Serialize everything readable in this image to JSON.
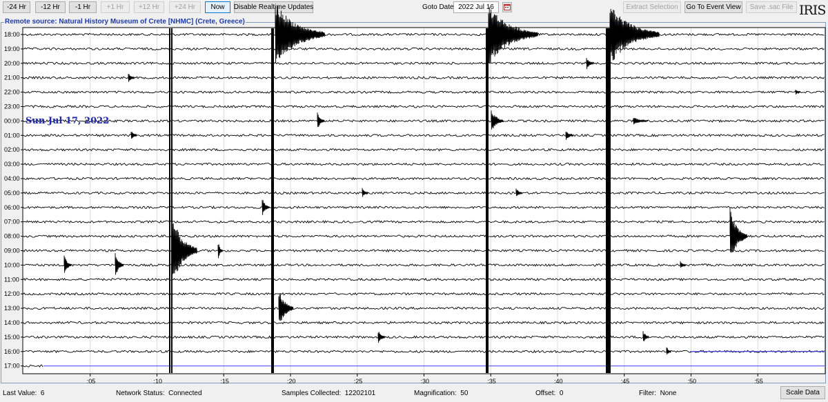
{
  "toolbar": {
    "buttons": [
      {
        "label": "-24 Hr",
        "enabled": true
      },
      {
        "label": "-12 Hr",
        "enabled": true
      },
      {
        "label": "-1 Hr",
        "enabled": true
      },
      {
        "label": "+1 Hr",
        "enabled": false
      },
      {
        "label": "+12 Hr",
        "enabled": false
      },
      {
        "label": "+24 Hr",
        "enabled": false
      },
      {
        "label": "Now",
        "enabled": true
      },
      {
        "label": "Disable Realtime Updates",
        "enabled": true
      }
    ],
    "goto_label": "Goto Date:",
    "goto_value": "2022 Jul 16",
    "right_buttons": [
      {
        "label": "Extract Selection",
        "enabled": false
      },
      {
        "label": "Go To Event View",
        "enabled": true
      },
      {
        "label": "Save .sac File",
        "enabled": false
      }
    ],
    "logo_text": "IRIS"
  },
  "source_title": "Remote source: Natural History Museum of Crete [NHMC] (Crete, Greece)",
  "date_annotation": "Sun Jul 17, 2022",
  "helicorder": {
    "hour_labels": [
      "18:00",
      "19:00",
      "20:00",
      "21:00",
      "22:00",
      "23:00",
      "00:00",
      "01:00",
      "02:00",
      "03:00",
      "04:00",
      "05:00",
      "06:00",
      "07:00",
      "08:00",
      "09:00",
      "10:00",
      "11:00",
      "12:00",
      "13:00",
      "14:00",
      "15:00",
      "16:00",
      "17:00"
    ],
    "minute_labels": [
      ":05",
      ":10",
      ":15",
      ":20",
      ":25",
      ":30",
      ":35",
      ":40",
      ":45",
      ":50",
      ":55"
    ],
    "minute_values": [
      5,
      10,
      15,
      20,
      25,
      30,
      35,
      40,
      45,
      50,
      55
    ],
    "minutes_per_line": 60,
    "last_trace_end_minute": 1.5,
    "trace_color": "#000000",
    "realtime_color": "#3b3bff"
  },
  "status": {
    "last_value_label": "Last Value:",
    "last_value": "6",
    "network_label": "Network Status:",
    "network_value": "Connected",
    "samples_label": "Samples Collected:",
    "samples_value": "12202101",
    "magnification_label": "Magnification:",
    "magnification_value": "50",
    "offset_label": "Offset:",
    "offset_value": "0",
    "filter_label": "Filter:",
    "filter_value": "None",
    "scale_button": "Scale Data"
  }
}
